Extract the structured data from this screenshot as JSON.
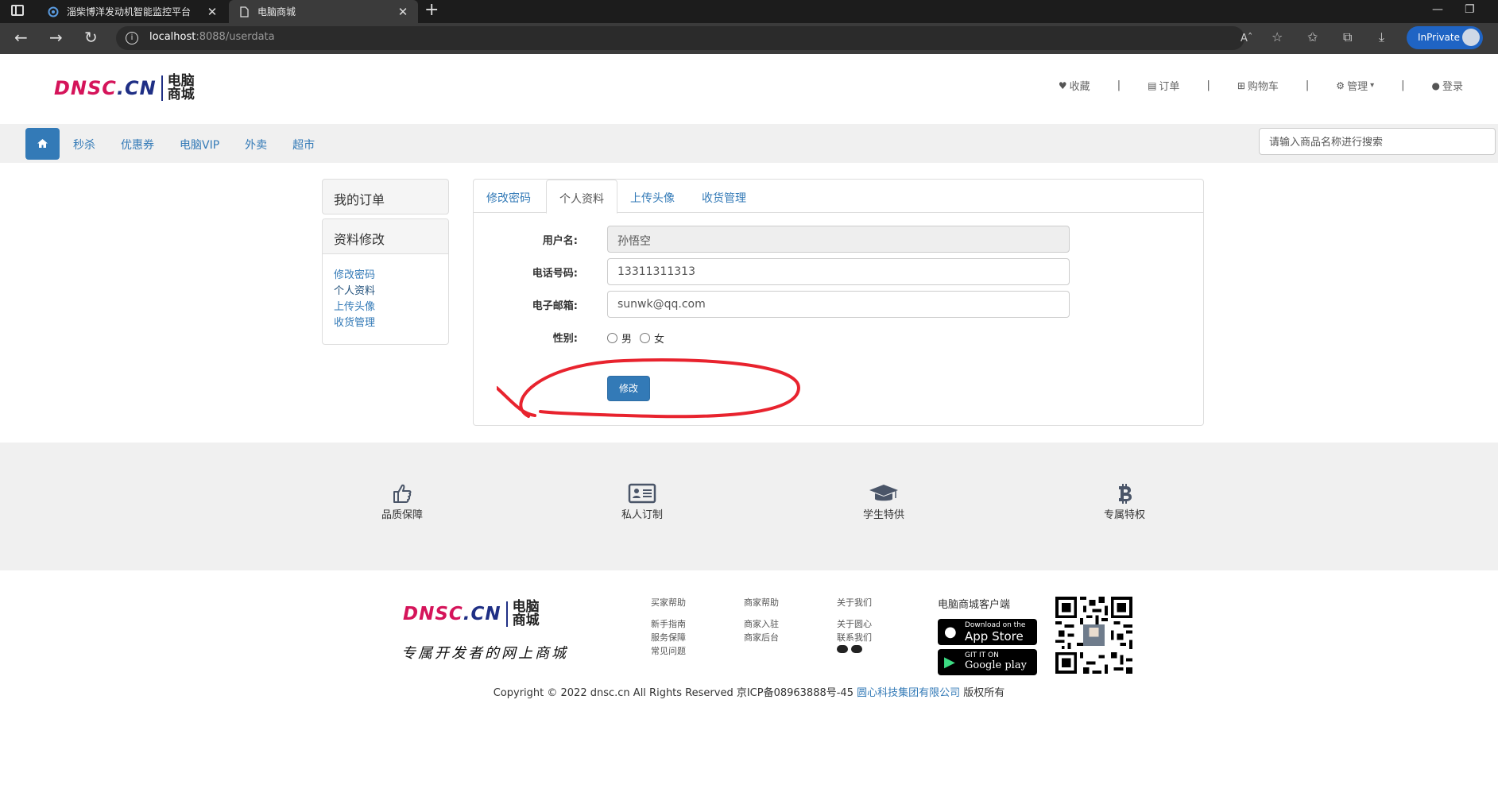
{
  "browser": {
    "tabs": [
      {
        "title": "淄柴博洋发动机智能监控平台",
        "close": "✕"
      },
      {
        "title": "电脑商城",
        "close": "✕"
      }
    ],
    "new_tab": "+",
    "minimize": "—",
    "restore": "❐",
    "address": {
      "host": "localhost",
      "rest": ":8088/userdata"
    },
    "inprivate_label": "InPrivate",
    "read_aloud": "Aˆ"
  },
  "header": {
    "logo": {
      "brand_red": "DNSC",
      "brand_blue": ".CN",
      "cn_line1": "电脑",
      "cn_line2": "商城"
    },
    "nav": [
      {
        "label": "收藏",
        "icon": "heart-icon",
        "glyph": "♥"
      },
      {
        "label": "订单",
        "icon": "file-icon",
        "glyph": "▤"
      },
      {
        "label": "购物车",
        "icon": "cart-icon",
        "glyph": "🛒"
      },
      {
        "label": "管理",
        "icon": "gears-icon",
        "glyph": "⚙",
        "caret": "▾"
      },
      {
        "label": "登录",
        "icon": "user-icon",
        "glyph": "👤"
      }
    ],
    "separator": "|"
  },
  "subnav": {
    "links": [
      "秒杀",
      "优惠券",
      "电脑VIP",
      "外卖",
      "超市"
    ],
    "search_placeholder": "请输入商品名称进行搜索"
  },
  "sidebar": {
    "orders_title": "我的订单",
    "profile_title": "资料修改",
    "links": [
      "修改密码",
      "个人资料",
      "上传头像",
      "收货管理"
    ]
  },
  "main": {
    "tabs": [
      "修改密码",
      "个人资料",
      "上传头像",
      "收货管理"
    ],
    "active_tab": 1,
    "form": {
      "username_label": "用户名:",
      "username_value": "孙悟空",
      "phone_label": "电话号码:",
      "phone_value": "13311311313",
      "email_label": "电子邮箱:",
      "email_value": "sunwk@qq.com",
      "gender_label": "性别:",
      "gender_options": [
        "男",
        "女"
      ],
      "submit_label": "修改"
    }
  },
  "features": [
    {
      "label": "品质保障",
      "icon": "thumbs-up-icon"
    },
    {
      "label": "私人订制",
      "icon": "id-card-icon"
    },
    {
      "label": "学生特供",
      "icon": "graduation-cap-icon"
    },
    {
      "label": "专属特权",
      "icon": "bitcoin-icon"
    }
  ],
  "footer": {
    "slogan": "专属开发者的网上商城",
    "columns": [
      {
        "title": "买家帮助",
        "links": [
          "新手指南",
          "服务保障",
          "常见问题"
        ]
      },
      {
        "title": "商家帮助",
        "links": [
          "商家入驻",
          "商家后台"
        ]
      },
      {
        "title": "关于我们",
        "links": [
          "关于圆心",
          "联系我们"
        ]
      }
    ],
    "client_title": "电脑商城客户端",
    "appstore": {
      "small": "Download on the",
      "big": "App Store"
    },
    "googleplay": {
      "small": "GIT IT ON",
      "big": "Google play"
    },
    "copyright_pre": "Copyright © 2022 dnsc.cn All Rights Reserved 京ICP备08963888号-45 ",
    "copyright_link": "圆心科技集团有限公司",
    "copyright_post": " 版权所有"
  },
  "colors": {
    "primary": "#337ab7",
    "annotation": "#e8232e",
    "logo_red": "#d5145a",
    "logo_blue": "#1f2f85"
  }
}
